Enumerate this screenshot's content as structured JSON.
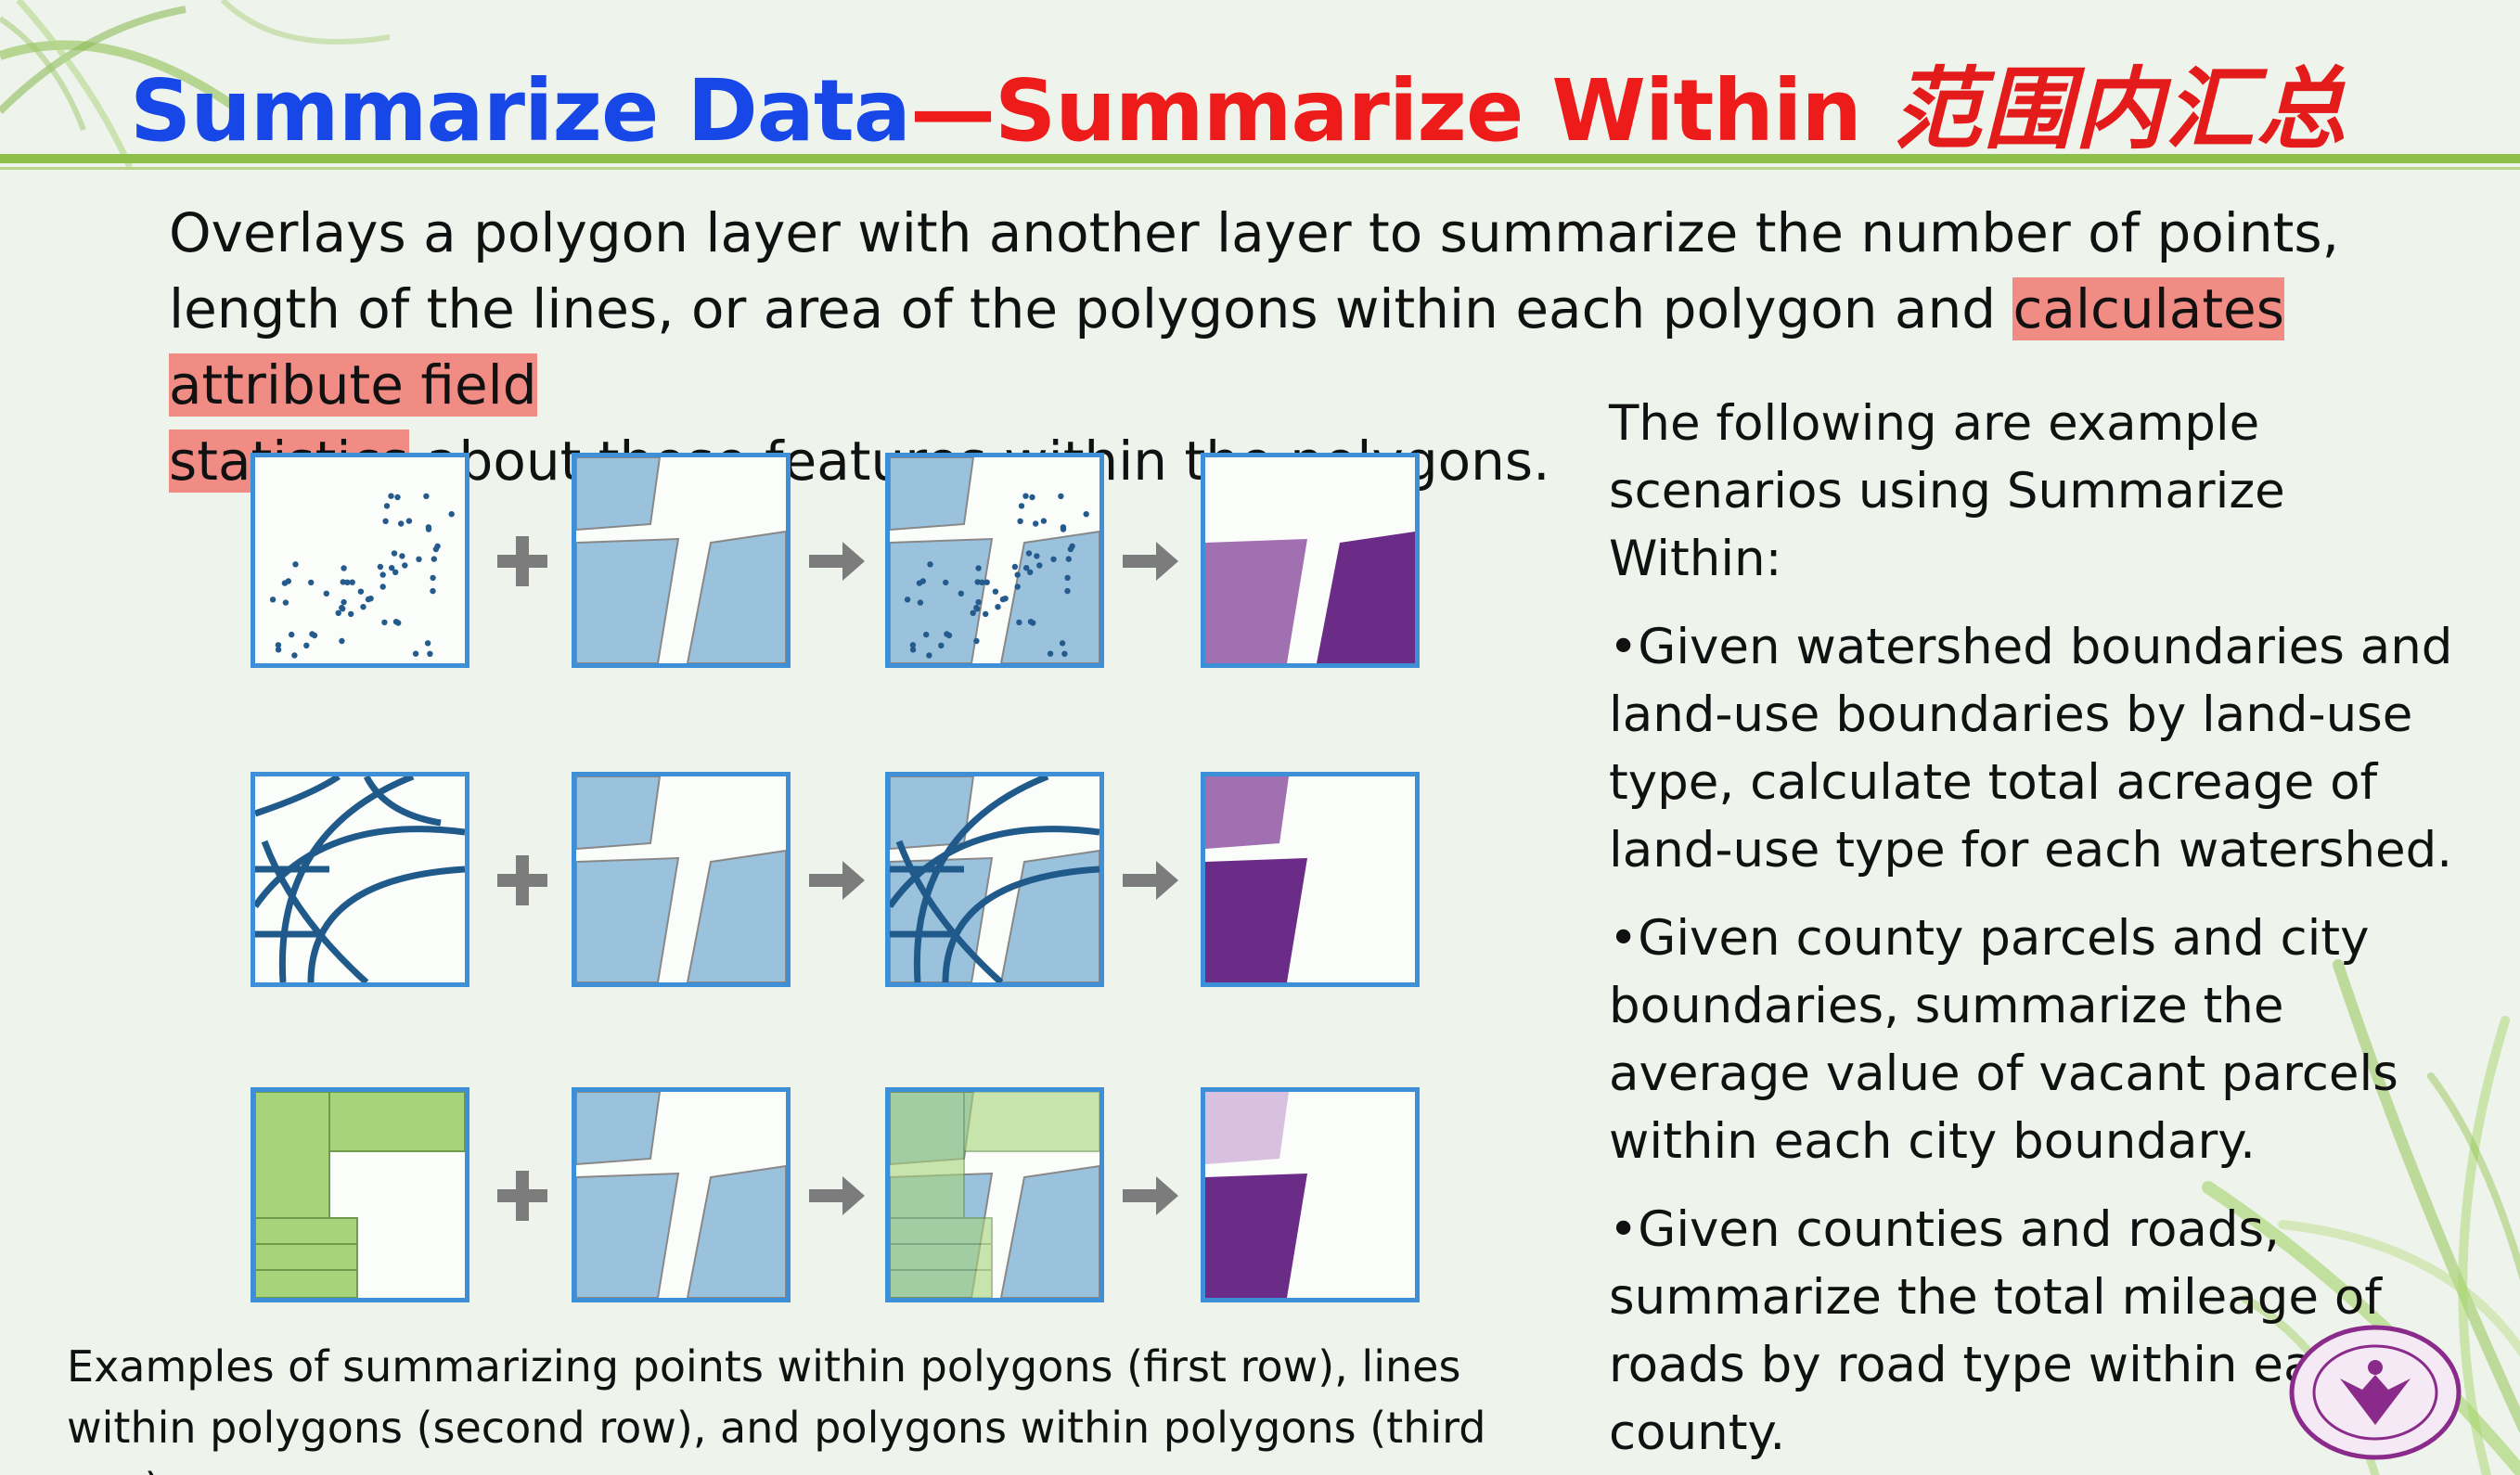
{
  "title": {
    "part1": "Summarize Data",
    "dash": "—",
    "part2": "Summarize Within",
    "chinese": "范围内汇总"
  },
  "intro": {
    "before": "Overlays a polygon layer with another layer to summarize the number of points, length of the lines, or area of the polygons within each polygon and ",
    "highlight1": "calculates attribute field",
    "highlight2": "statistics",
    "after": " about those features within the polygons."
  },
  "scenarios": {
    "heading": "The following are example scenarios using Summarize Within:",
    "items": [
      "•Given watershed boundaries and land-use boundaries by land-use type, calculate total acreage of land-use type for each watershed.",
      "•Given county parcels and city boundaries, summarize the average value of vacant parcels within each city boundary.",
      "•Given counties and roads, summarize the total mileage of roads by road type within each county."
    ]
  },
  "caption": "Examples of summarizing points within polygons (first row), lines within polygons (second row), and polygons within polygons (third row)",
  "icons": {
    "plus": "plus-icon",
    "arrow": "arrow-right-icon",
    "logo": "university-seal-icon"
  },
  "colors": {
    "title_blue": "#1747e6",
    "title_red": "#ee1b1b",
    "highlight": "#f08c84",
    "box_border": "#3d8fd8",
    "polygon_blue": "#9bc2dd",
    "point_blue": "#245a8c",
    "line_blue": "#1f5a8a",
    "polygon_green": "#a7d47a",
    "purple_light": "#a070b0",
    "purple_dark": "#6a2c86",
    "lavender": "#d7c0e0"
  }
}
